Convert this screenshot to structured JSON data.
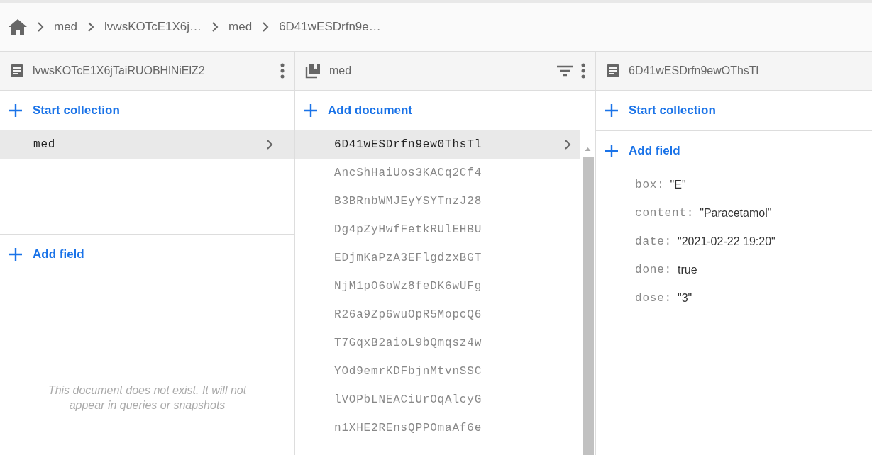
{
  "breadcrumb": [
    {
      "label": "med"
    },
    {
      "label": "lvwsKOTcE1X6j…"
    },
    {
      "label": "med"
    },
    {
      "label": "6D41wESDrfn9e…"
    }
  ],
  "panels": [
    {
      "kind": "document",
      "title": "lvwsKOTcE1X6jTaiRUOBHlNiElZ2",
      "add_top": "Start collection",
      "items": [
        {
          "label": "med",
          "selected": true
        }
      ],
      "add_bottom": "Add field",
      "notice": "This document does not exist. It will not appear in queries or snapshots"
    },
    {
      "kind": "collection",
      "title": "med",
      "add_top": "Add document",
      "items": [
        {
          "label": "6D41wESDrfn9ew0ThsTl",
          "selected": true
        },
        {
          "label": "AncShHaiUos3KACq2Cf4",
          "selected": false
        },
        {
          "label": "B3BRnbWMJEyYSYTnzJ28",
          "selected": false
        },
        {
          "label": "Dg4pZyHwfFetkRUlEHBU",
          "selected": false
        },
        {
          "label": "EDjmKaPzA3EFlgdzxBGT",
          "selected": false
        },
        {
          "label": "NjM1pO6oWz8feDK6wUFg",
          "selected": false
        },
        {
          "label": "R26a9Zp6wuOpR5MopcQ6",
          "selected": false
        },
        {
          "label": "T7GqxB2aioL9bQmqsz4w",
          "selected": false
        },
        {
          "label": "YOd9emrKDFbjnMtvnSSC",
          "selected": false
        },
        {
          "label": "lVOPbLNEACiUrOqAlcyG",
          "selected": false
        },
        {
          "label": "n1XHE2REnsQPPOmaAf6e",
          "selected": false
        }
      ]
    },
    {
      "kind": "document",
      "title": "6D41wESDrfn9ewOThsTl",
      "add_top": "Start collection",
      "add_bottom": "Add field",
      "fields": [
        {
          "key": "box:",
          "value": "\"E\""
        },
        {
          "key": "content:",
          "value": "\"Paracetamol\""
        },
        {
          "key": "date:",
          "value": "\"2021-02-22 19:20\""
        },
        {
          "key": "done:",
          "value": "true"
        },
        {
          "key": "dose:",
          "value": "\"3\""
        }
      ]
    }
  ]
}
